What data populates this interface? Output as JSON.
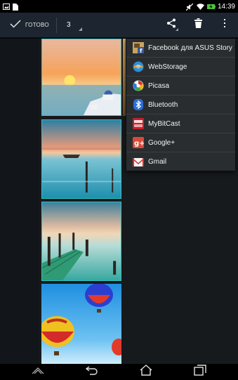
{
  "status_bar": {
    "time": "14:39",
    "icons": [
      "gallery-icon",
      "document-icon",
      "mute-icon",
      "wifi-icon",
      "battery-charging-icon"
    ]
  },
  "action_bar": {
    "done_label": "ГОТОВО",
    "selected_count": "3",
    "actions": [
      "share-icon",
      "delete-icon",
      "overflow-menu-icon"
    ]
  },
  "share_menu": {
    "items": [
      {
        "label": "Facebook для ASUS Story",
        "icon": "facebook-asus-story-icon"
      },
      {
        "label": "WebStorage",
        "icon": "webstorage-icon"
      },
      {
        "label": "Picasa",
        "icon": "picasa-icon"
      },
      {
        "label": "Bluetooth",
        "icon": "bluetooth-icon"
      },
      {
        "label": "MyBitCast",
        "icon": "mybitcast-icon"
      },
      {
        "label": "Google+",
        "icon": "google-plus-icon"
      },
      {
        "label": "Gmail",
        "icon": "gmail-icon"
      }
    ]
  },
  "gallery": {
    "thumbnails": [
      "sunset-santorini-photo",
      "lake-pier-photo",
      "wooden-pier-photo",
      "hot-air-balloons-photo"
    ]
  },
  "nav_bar": {
    "buttons": [
      "recent-up-icon",
      "back-icon",
      "home-icon",
      "recent-apps-icon"
    ]
  },
  "colors": {
    "action_bar_bg": "#1c2530",
    "selection_border": "#27c7c7",
    "menu_bg": "#2a2d30"
  }
}
